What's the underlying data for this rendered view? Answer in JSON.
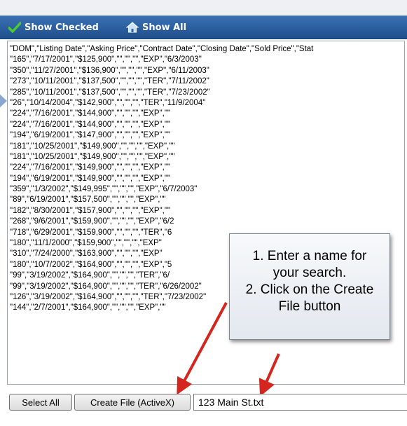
{
  "toolbar": {
    "show_checked_label": "Show Checked",
    "show_all_label": "Show All",
    "accent": "#2a5c9e"
  },
  "textbox": {
    "lines": [
      "\"DOM\",\"Listing Date\",\"Asking Price\",\"Contract Date\",\"Closing Date\",\"Sold Price\",\"Stat",
      "\"165\",\"7/17/2001\",\"$125,900\",\"\",\"\",\"\",\"EXP\",\"6/3/2003\"",
      "\"350\",\"11/27/2001\",\"$136,900\",\"\",\"\",\"\",\"EXP\",\"6/11/2003\"",
      "\"273\",\"10/11/2001\",\"$137,500\",\"\",\"\",\"\",\"TER\",\"7/11/2002\"",
      "\"285\",\"10/11/2001\",\"$137,500\",\"\",\"\",\"\",\"TER\",\"7/23/2002\"",
      "\"26\",\"10/14/2004\",\"$142,900\",\"\",\"\",\"\",\"TER\",\"11/9/2004\"",
      "\"224\",\"7/16/2001\",\"$144,900\",\"\",\"\",\"\",\"EXP\",\"\"",
      "\"224\",\"7/16/2001\",\"$144,900\",\"\",\"\",\"\",\"EXP\",\"\"",
      "\"194\",\"6/19/2001\",\"$147,900\",\"\",\"\",\"\",\"EXP\",\"\"",
      "\"181\",\"10/25/2001\",\"$149,900\",\"\",\"\",\"\",\"EXP\",\"\"",
      "\"181\",\"10/25/2001\",\"$149,900\",\"\",\"\",\"\",\"EXP\",\"\"",
      "\"224\",\"7/16/2001\",\"$149,900\",\"\",\"\",\"\",\"EXP\",\"\"",
      "\"194\",\"6/19/2001\",\"$149,900\",\"\",\"\",\"\",\"EXP\",\"\"",
      "\"359\",\"1/3/2002\",\"$149,995\",\"\",\"\",\"\",\"EXP\",\"6/7/2003\"",
      "\"89\",\"6/19/2001\",\"$157,500\",\"\",\"\",\"\",\"EXP\",\"\"",
      "\"182\",\"8/30/2001\",\"$157,900\",\"\",\"\",\"\",\"EXP\",\"\"",
      "\"268\",\"9/6/2001\",\"$159,900\",\"\",\"\",\"\",\"EXP\",\"6/2",
      "\"718\",\"6/29/2001\",\"$159,900\",\"\",\"\",\"\",\"TER\",\"6",
      "\"180\",\"11/1/2000\",\"$159,900\",\"\",\"\",\"\",\"EXP\"",
      "\"310\",\"7/24/2000\",\"$163,900\",\"\",\"\",\"\",\"EXP\"",
      "\"180\",\"10/7/2002\",\"$164,900\",\"\",\"\",\"\",\"EXP\",\"5",
      "\"99\",\"3/19/2002\",\"$164,900\",\"\",\"\",\"\",\"TER\",\"6/",
      "\"99\",\"3/19/2002\",\"$164,900\",\"\",\"\",\"\",\"TER\",\"6/26/2002\"",
      "\"126\",\"3/19/2002\",\"$164,900\",\"\",\"\",\"\",\"TER\",\"7/23/2002\"",
      "\"144\",\"2/7/2001\",\"$164,900\",\"\",\"\",\"\",\"EXP\",\"\""
    ]
  },
  "callout": {
    "line1": "1. Enter a name for",
    "line2": "your search.",
    "line3": "2. Click on the Create",
    "line4": "File button",
    "arrow_color": "#d4261f"
  },
  "bottom": {
    "select_all_label": "Select All",
    "create_file_label": "Create File (ActiveX)",
    "filename_value": "123 Main St.txt"
  }
}
